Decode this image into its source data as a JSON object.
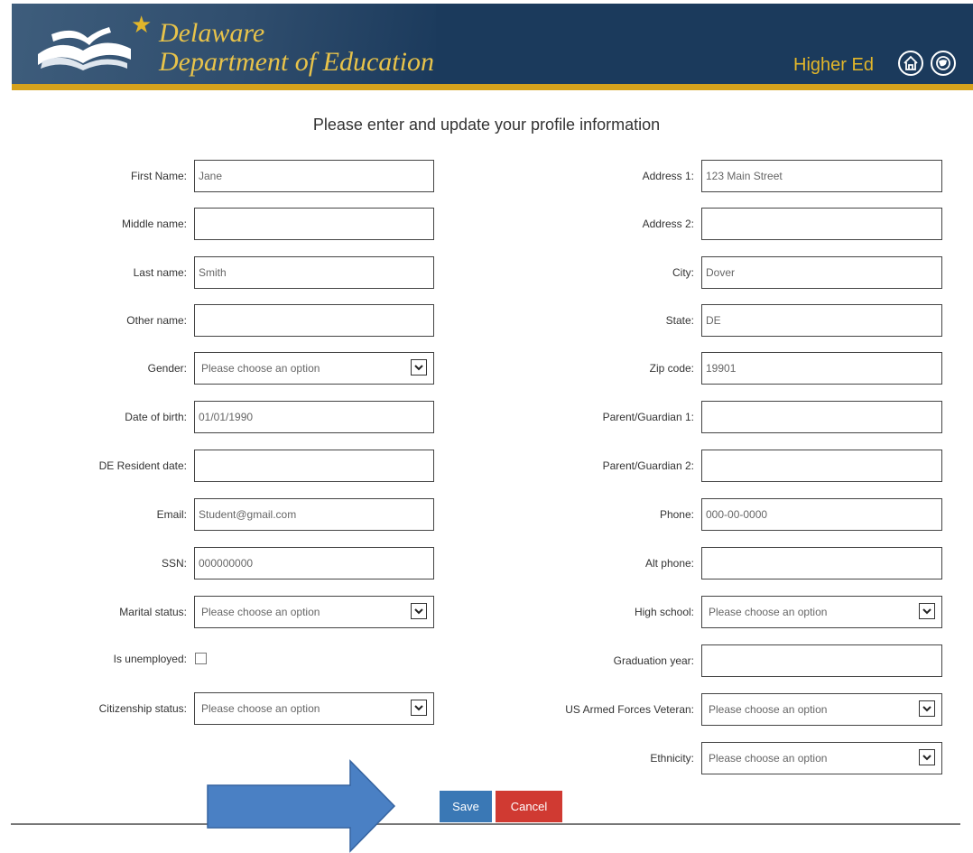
{
  "header": {
    "title_line1": "Delaware",
    "title_line2": "Department of Education",
    "higher_ed": "Higher Ed",
    "colors": {
      "background": "#1b3a5c",
      "accent": "#d6a21c",
      "title": "#e8c34a"
    },
    "icons": [
      "book-logo-icon",
      "star-icon",
      "home-icon",
      "globe-icon"
    ]
  },
  "heading": "Please enter and update your profile information",
  "left": {
    "first_name_label": "First Name:",
    "first_name_value": "Jane",
    "middle_name_label": "Middle name:",
    "middle_name_value": "",
    "last_name_label": "Last name:",
    "last_name_value": "Smith",
    "other_name_label": "Other name:",
    "other_name_value": "",
    "gender_label": "Gender:",
    "gender_value": "Please choose an option",
    "dob_label": "Date of birth:",
    "dob_value": "01/01/1990",
    "resident_label": "DE Resident date:",
    "resident_value": "",
    "email_label": "Email:",
    "email_value": "Student@gmail.com",
    "ssn_label": "SSN:",
    "ssn_value": "000000000",
    "marital_label": "Marital status:",
    "marital_value": "Please choose an option",
    "unemployed_label": "Is unemployed:",
    "unemployed_checked": false,
    "citizenship_label": "Citizenship status:",
    "citizenship_value": "Please choose an option"
  },
  "right": {
    "address1_label": "Address 1:",
    "address1_value": "123 Main Street",
    "address2_label": "Address 2:",
    "address2_value": "",
    "city_label": "City:",
    "city_value": "Dover",
    "state_label": "State:",
    "state_value": "DE",
    "zip_label": "Zip code:",
    "zip_value": "19901",
    "guardian1_label": "Parent/Guardian 1:",
    "guardian1_value": "",
    "guardian2_label": "Parent/Guardian 2:",
    "guardian2_value": "",
    "phone_label": "Phone:",
    "phone_value": "000-00-0000",
    "alt_phone_label": "Alt phone:",
    "alt_phone_value": "",
    "high_school_label": "High school:",
    "high_school_value": "Please choose an option",
    "grad_year_label": "Graduation year:",
    "grad_year_value": "",
    "veteran_label": "US Armed Forces Veteran:",
    "veteran_value": "Please choose an option",
    "ethnicity_label": "Ethnicity:",
    "ethnicity_value": "Please choose an option"
  },
  "buttons": {
    "save": "Save",
    "cancel": "Cancel",
    "save_color": "#3a78b5",
    "cancel_color": "#d03a32"
  },
  "annotation": {
    "icon": "blue-arrow-icon",
    "color": "#4a80c4"
  }
}
